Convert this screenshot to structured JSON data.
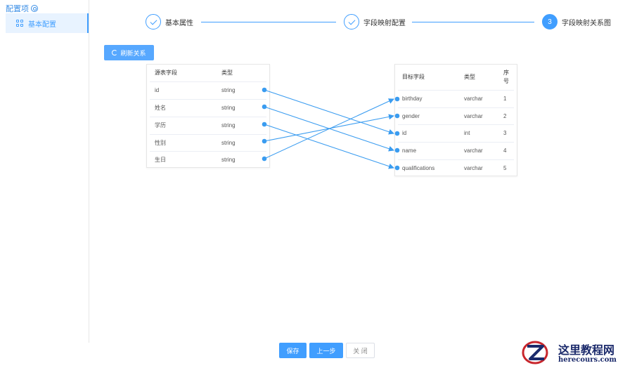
{
  "sidebar": {
    "title": "配置项",
    "items": [
      {
        "label": "基本配置"
      }
    ]
  },
  "steps": [
    {
      "label": "基本属性",
      "status": "done"
    },
    {
      "label": "字段映射配置",
      "status": "done"
    },
    {
      "number": "3",
      "label": "字段映射关系图",
      "status": "active"
    }
  ],
  "toolbar": {
    "refresh_label": "刷新关系"
  },
  "source_table": {
    "headers": [
      "源表字段",
      "类型"
    ],
    "rows": [
      [
        "id",
        "string"
      ],
      [
        "姓名",
        "string"
      ],
      [
        "学历",
        "string"
      ],
      [
        "性别",
        "string"
      ],
      [
        "生日",
        "string"
      ]
    ]
  },
  "target_table": {
    "headers": [
      "目标字段",
      "类型",
      "序",
      "号"
    ],
    "rows": [
      [
        "birthday",
        "varchar",
        "1"
      ],
      [
        "gender",
        "varchar",
        "2"
      ],
      [
        "id",
        "int",
        "3"
      ],
      [
        "name",
        "varchar",
        "4"
      ],
      [
        "qualifications",
        "varchar",
        "5"
      ]
    ]
  },
  "mappings": [
    {
      "from": "id",
      "to": "id"
    },
    {
      "from": "姓名",
      "to": "name"
    },
    {
      "from": "学历",
      "to": "qualifications"
    },
    {
      "from": "性别",
      "to": "gender"
    },
    {
      "from": "生日",
      "to": "birthday"
    }
  ],
  "footer": {
    "save_label": "保存",
    "prev_label": "上一步",
    "close_label": "关 闭"
  },
  "watermark": {
    "cn": "这里教程网",
    "en": "herecours.com"
  },
  "colors": {
    "accent": "#409eff",
    "line": "#3a9cf0"
  }
}
